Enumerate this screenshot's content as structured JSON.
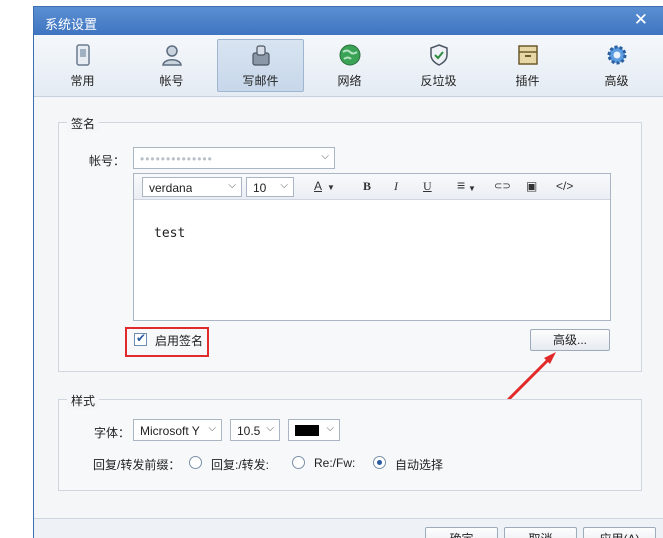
{
  "window": {
    "title": "系统设置",
    "close_glyph": "✕"
  },
  "toolbar": {
    "items": [
      {
        "label": "常用",
        "icon": "phone-icon",
        "active": false
      },
      {
        "label": "帐号",
        "icon": "user-icon",
        "active": false
      },
      {
        "label": "写邮件",
        "icon": "compose-icon",
        "active": true
      },
      {
        "label": "网络",
        "icon": "globe-icon",
        "active": false
      },
      {
        "label": "反垃圾",
        "icon": "shield-icon",
        "active": false
      },
      {
        "label": "插件",
        "icon": "plugin-icon",
        "active": false
      },
      {
        "label": "高级",
        "icon": "gear-icon",
        "active": false
      }
    ]
  },
  "signature": {
    "legend": "签名",
    "account_label": "帐号：",
    "account_value": "••••••••••••••",
    "font_family": "verdana",
    "font_size": "10",
    "editor_text": "test",
    "enable_label": "启用签名",
    "enabled": true,
    "advanced_button": "高级..."
  },
  "editor_toolbar": {
    "font_color": "A",
    "bold": "B",
    "italic": "I",
    "underline": "U",
    "align_glyph": "≡",
    "link_glyph": "⊂⊃",
    "image_glyph": "▣",
    "code_glyph": "</>"
  },
  "style": {
    "legend": "样式",
    "font_label": "字体：",
    "font_value": "Microsoft Y",
    "size_value": "10.5",
    "color_value": "#000000",
    "prefix_label": "回复/转发前缀：",
    "options": [
      {
        "label": "回复:/转发:",
        "selected": false
      },
      {
        "label": "Re:/Fw:",
        "selected": false
      },
      {
        "label": "自动选择",
        "selected": true
      }
    ]
  },
  "footer": {
    "ok": "确定",
    "cancel": "取消",
    "apply": "应用(A)"
  },
  "colors": {
    "highlight_border": "#e12a2a",
    "arrow": "#e12a2a",
    "titlebar": "#4a80c8"
  }
}
